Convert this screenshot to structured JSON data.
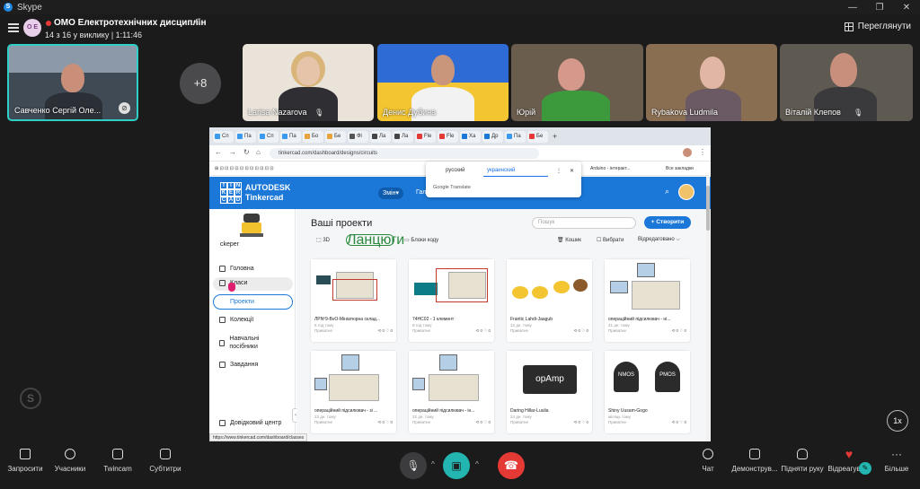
{
  "app": {
    "title": "Skype",
    "logo_letter": "S"
  },
  "call": {
    "group_initials": "О Е",
    "name": "ОМО Електротехнічних дисциплін",
    "meta": "14 з 16 у виклику | 1:11:46",
    "view_label": "Переглянути"
  },
  "participants": [
    {
      "name": "Савченко Сергій Оле..."
    },
    {
      "name": "Larisa Nazarova"
    },
    {
      "name": "Денис Дубина"
    },
    {
      "name": "Юрій"
    },
    {
      "name": "Rybakova Ludmila"
    },
    {
      "name": "Віталій Клепов"
    }
  ],
  "more_count": "+8",
  "browser": {
    "tabs": [
      "Сп",
      "Па",
      "Сп",
      "Па",
      "Бо",
      "Бе",
      "Фі",
      "Ла",
      "Ла",
      "Fle",
      "Fle",
      "Ха",
      "Др",
      "Па",
      "Бе"
    ],
    "url": "tinkercad.com/dashboard/designs/circuits",
    "bookmarks": [
      "Arduino - інтеракт...",
      "Все закладки"
    ],
    "status_url": "https://www.tinkercad.com/dashboard/classes"
  },
  "translate": {
    "lang1": "русский",
    "lang2": "украинский",
    "provider": "Google Translate"
  },
  "tinkercad": {
    "brand_line1": "AUTODESK",
    "brand_line2": "Tinkercad",
    "switch_label": "Змін▾",
    "gallery_label": "Гал",
    "username": "ckeper",
    "sidebar": [
      "Головна",
      "Класи",
      "Проекти",
      "Колекції",
      "Навчальні посібники",
      "Завдання",
      "Довідковий центр"
    ],
    "page_title": "Ваші проекти",
    "search_placeholder": "Пошук",
    "create_label": "+ Створити",
    "filters": {
      "f3d": "3D",
      "circuits": "Ланцюги",
      "blocks": "Блоки коду",
      "trash": "Кошик",
      "select": "Вибрати",
      "sort": "Відредаговано ⌵"
    },
    "projects": [
      {
        "title": "ЛРNº9-BvO-Мініатюрна склад...",
        "time": "6 год тому",
        "privacy": "Приватне",
        "stats": "⟲ 0  ♡ 0"
      },
      {
        "title": "74HC02 - 1 клемент",
        "time": "9 год тому",
        "privacy": "Приватне",
        "stats": "⟲ 0  ♡ 0"
      },
      {
        "title": "Frantic Lahdi-Jaagub",
        "time": "12 дн. тому",
        "privacy": "Приватне",
        "stats": "⟲ 0  ♡ 0"
      },
      {
        "title": "операційний підсилювач - ні...",
        "time": "21 дн. тому",
        "privacy": "Приватне",
        "stats": "⟲ 0  ♡ 0"
      },
      {
        "title": "операційний підсилювач - зі ...",
        "time": "22 дн. тому",
        "privacy": "Приватне",
        "stats": "⟲ 0  ♡ 0"
      },
      {
        "title": "операційний підсилювач - ін...",
        "time": "22 дн. тому",
        "privacy": "Приватне",
        "stats": "⟲ 0  ♡ 0"
      },
      {
        "title": "Daring Hillar-Luulia",
        "time": "24 дн. тому",
        "privacy": "Приватне",
        "stats": "⟲ 0  ♡ 0"
      },
      {
        "title": "Shiny Uusam-Gogo",
        "time": "місяць тому",
        "privacy": "Приватне",
        "stats": "⟲ 0  ♡ 0"
      }
    ],
    "opamp_label": "opAmp",
    "nmos_label": "NMOS",
    "pmos_label": "PMOS"
  },
  "controls": {
    "invite": "Запросити",
    "participants": "Учасники",
    "twincam": "Twincam",
    "subtitles": "Субтитри",
    "chat": "Чат",
    "share": "Демонструв...",
    "raise_hand": "Підняти руку",
    "react": "Відреагува...",
    "more": "Більше",
    "speed": "1x"
  },
  "colors": {
    "accent": "#23b6b0",
    "hangup": "#e53935",
    "tinkercad_blue": "#1b78d9"
  }
}
